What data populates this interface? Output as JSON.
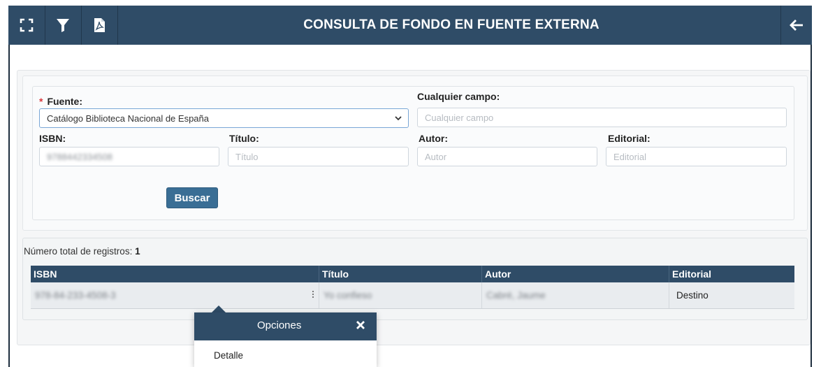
{
  "topbar": {
    "title": "CONSULTA DE FONDO EN FUENTE EXTERNA",
    "icons": [
      "fullscreen-icon",
      "filter-icon",
      "pdf-icon",
      "arrow-left-icon"
    ],
    "color": "#2f4c67"
  },
  "form": {
    "fuente_label": "Fuente:",
    "required_mark": "*",
    "fuente_value": "Catálogo Biblioteca Nacional de España",
    "cualquier_label": "Cualquier campo:",
    "cualquier_placeholder": "Cualquier campo",
    "isbn_label": "ISBN:",
    "isbn_value": "9788442334508",
    "titulo_label": "Título:",
    "titulo_placeholder": "Título",
    "autor_label": "Autor:",
    "autor_placeholder": "Autor",
    "editorial_label": "Editorial:",
    "editorial_placeholder": "Editorial",
    "buscar_label": "Buscar"
  },
  "results": {
    "total_label": "Número total de registros:",
    "total_value": "1",
    "columns": [
      "ISBN",
      "Título",
      "Autor",
      "Editorial"
    ],
    "rows": [
      {
        "isbn": "978-84-233-4508-3",
        "titulo": "Yo confieso",
        "autor": "Cabré, Jaume",
        "editorial": "Destino"
      }
    ]
  },
  "popover": {
    "title": "Opciones",
    "items": [
      "Detalle"
    ]
  }
}
